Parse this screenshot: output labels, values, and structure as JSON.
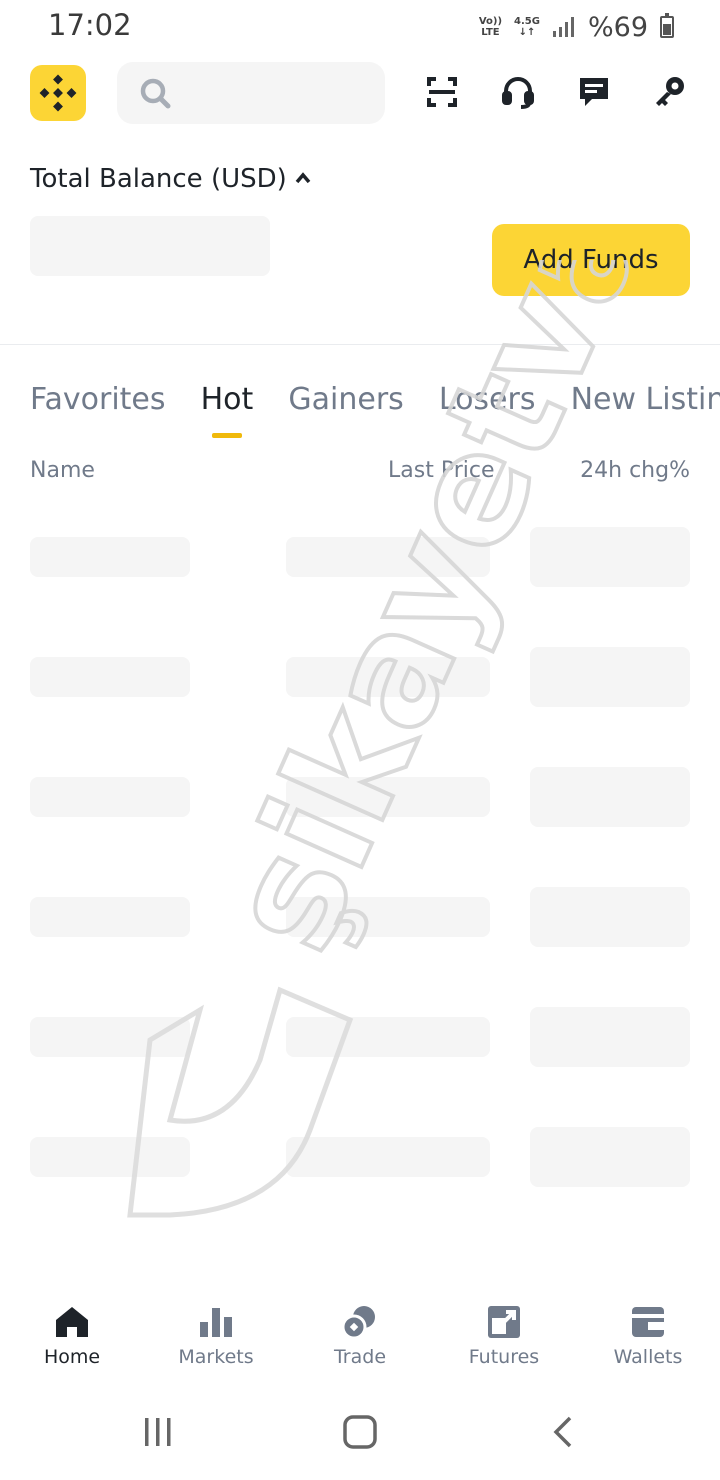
{
  "status_bar": {
    "time": "17:02",
    "volte_top": "Vo))",
    "volte_bottom": "LTE",
    "network_top": "4.5G",
    "network_bottom": "↓↑",
    "battery": "%69"
  },
  "header": {
    "search_placeholder": ""
  },
  "balance": {
    "title": "Total Balance  (USD)",
    "add_funds_label": "Add Funds"
  },
  "market_tabs": [
    {
      "label": "Favorites",
      "active": false
    },
    {
      "label": "Hot",
      "active": true
    },
    {
      "label": "Gainers",
      "active": false
    },
    {
      "label": "Losers",
      "active": false
    },
    {
      "label": "New Listings",
      "active": false
    }
  ],
  "table_headers": {
    "name": "Name",
    "last_price": "Last Price",
    "change": "24h chg%"
  },
  "bottom_nav": [
    {
      "label": "Home",
      "icon": "home-icon",
      "active": true
    },
    {
      "label": "Markets",
      "icon": "markets-icon",
      "active": false
    },
    {
      "label": "Trade",
      "icon": "trade-icon",
      "active": false
    },
    {
      "label": "Futures",
      "icon": "futures-icon",
      "active": false
    },
    {
      "label": "Wallets",
      "icon": "wallets-icon",
      "active": false
    }
  ],
  "watermark_text": "şikayetvar",
  "colors": {
    "brand_yellow": "#fcd535",
    "tab_indicator": "#f0b90b",
    "text_primary": "#1e2329",
    "text_secondary": "#707a8a",
    "skeleton": "#f5f5f5"
  }
}
